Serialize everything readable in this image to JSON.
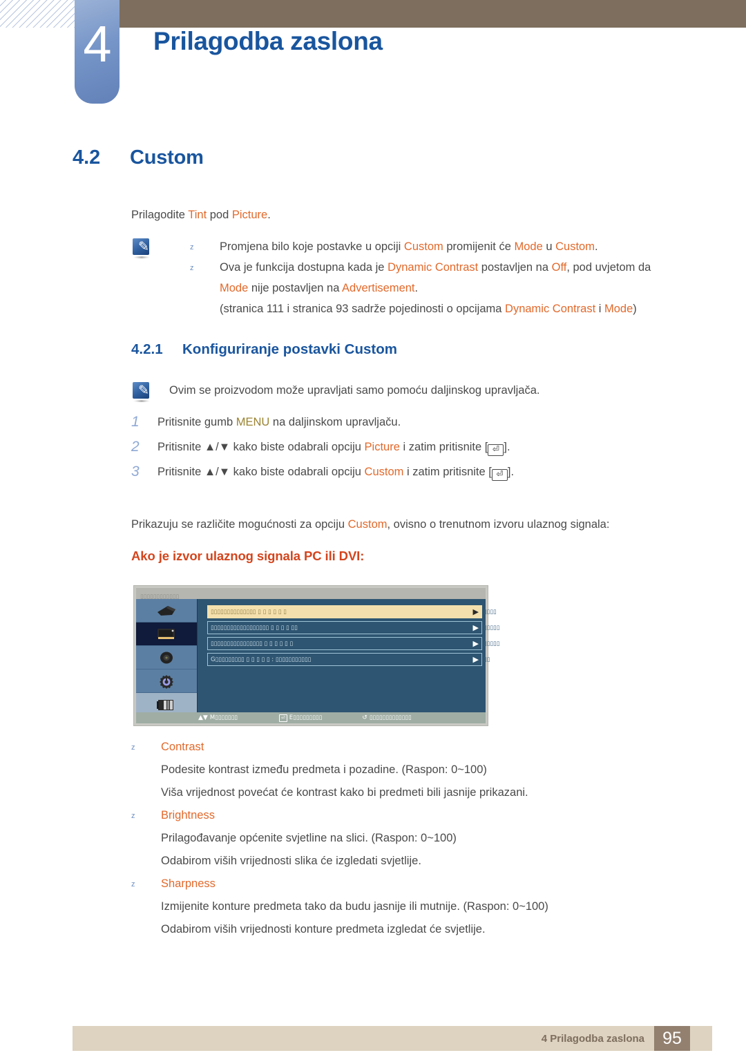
{
  "header": {
    "chapter_number": "4",
    "chapter_title": "Prilagodba zaslona"
  },
  "section": {
    "number": "4.2",
    "title": "Custom",
    "intro_pre": "Prilagodite ",
    "intro_kw1": "Tint",
    "intro_mid": " pod ",
    "intro_kw2": "Picture",
    "intro_end": "."
  },
  "note_box_1": {
    "icon": "note-pencil-icon",
    "bullets": [
      {
        "marker": "z",
        "p1": "Promjena bilo koje postavke u opciji ",
        "k1": "Custom",
        "p2": " promijenit će ",
        "k2": "Mode",
        "p3": " u ",
        "k3": "Custom",
        "p4": "."
      },
      {
        "marker": "z",
        "p1": "Ova je funkcija dostupna kada je ",
        "k1": "Dynamic Contrast",
        "p2": " postavljen na ",
        "k2": "Off",
        "p3": ", pod uvjetom da ",
        "k3": "Mode",
        "p4": " nije postavljen na ",
        "k4": "Advertisement",
        "p5": "."
      }
    ],
    "reference": {
      "p1": "(stranica 111 i stranica 93 sadrže pojedinosti o opcijama ",
      "k1": "Dynamic Contrast",
      "p2": " i ",
      "k2": "Mode",
      "p3": ")"
    }
  },
  "subsection": {
    "number": "4.2.1",
    "title": "Konfiguriranje postavki Custom"
  },
  "note_box_2": {
    "icon": "note-pencil-icon",
    "text": "Ovim se proizvodom može upravljati samo pomoću daljinskog upravljača."
  },
  "steps": [
    {
      "number": "1",
      "p1": "Pritisnite gumb ",
      "kw": "MENU",
      "kw_color": "gold",
      "p2": " na daljinskom upravljaču.",
      "has_key": false
    },
    {
      "number": "2",
      "p1": "Pritisnite ▲/▼ kako biste odabrali opciju ",
      "kw": "Picture",
      "kw_color": "orange",
      "p2": " i zatim pritisnite [",
      "key_glyph": "⏎",
      "p3": "].",
      "has_key": true
    },
    {
      "number": "3",
      "p1": "Pritisnite ▲/▼ kako biste odabrali opciju ",
      "kw": "Custom",
      "kw_color": "orange",
      "p2": " i zatim pritisnite [",
      "key_glyph": "⏎",
      "p3": "].",
      "has_key": true
    }
  ],
  "mid_paragraph": {
    "p1": "Prikazuju se različite mogućnosti za opciju ",
    "k1": "Custom",
    "p2": ", ovisno o trenutnom izvoru ulaznog signala:"
  },
  "red_heading": "Ako je izvor ulaznog signala PC ili DVI:",
  "osd": {
    "title_placeholder": "▯▯▯▯▯▯▯▯▯▯▯▯",
    "sidebar_icons": [
      {
        "name": "input-source-icon",
        "selected": false
      },
      {
        "name": "picture-display-icon",
        "selected": true
      },
      {
        "name": "sound-speaker-icon",
        "selected": false
      },
      {
        "name": "setup-gear-icon",
        "selected": false
      },
      {
        "name": "multi-control-icon",
        "selected": false
      }
    ],
    "rows": [
      {
        "label": "▯▯▯▯▯▯▯▯▯▯▯▯▯▯   ▯     ▯     ▯     ▯     ▯     ▯",
        "arrow": "▶",
        "ghost": "▯▯▯▯",
        "highlighted": true
      },
      {
        "label": "▯▯▯▯▯▯▯▯▯▯▯▯▯▯▯▯▯▯    ▯     ▯     ▯    ▯    ▯▯",
        "arrow": "▶",
        "ghost": "▯▯▯▯▯",
        "highlighted": false
      },
      {
        "label": "▯▯▯▯▯▯▯▯▯▯▯▯▯▯▯▯ ▯    ▯     ▯     ▯     ▯     ▯",
        "arrow": "▶",
        "ghost": "▯▯▯▯▯",
        "highlighted": false
      },
      {
        "label": "G▯▯▯▯▯▯▯▯▯ ▯    ▯    ▯    ▯    ▯     : ▯▯▯▯▯▯▯▯▯▯▯",
        "arrow": "▶",
        "ghost": "▯▯",
        "highlighted": false
      }
    ],
    "bottom_bar": [
      {
        "icon": "▲▼",
        "key": "",
        "label": "M▯▯▯▯▯▯▯"
      },
      {
        "icon": "",
        "key": "⏎",
        "label": "E▯▯▯▯▯▯▯▯▯"
      },
      {
        "icon": "↺",
        "key": "",
        "label": "▯▯▯▯▯▯▯▯▯▯▯▯▯"
      }
    ]
  },
  "definitions": [
    {
      "marker": "z",
      "term": "Contrast",
      "lines": [
        "Podesite kontrast između predmeta i pozadine. (Raspon: 0~100)",
        "Viša vrijednost povećat će kontrast kako bi predmeti bili jasnije prikazani."
      ]
    },
    {
      "marker": "z",
      "term": "Brightness",
      "lines": [
        "Prilagođavanje općenite svjetline na slici. (Raspon: 0~100)",
        "Odabirom viših vrijednosti slika će izgledati svjetlije."
      ]
    },
    {
      "marker": "z",
      "term": "Sharpness",
      "lines": [
        "Izmijenite konture predmeta tako da budu jasnije ili mutnije. (Raspon: 0~100)",
        "Odabirom viših vrijednosti konture predmeta izgledat će svjetlije."
      ]
    }
  ],
  "footer": {
    "label": "4 Prilagodba zaslona",
    "page_number": "95"
  },
  "colors": {
    "heading_blue": "#19559e",
    "keyword_orange": "#e2692b",
    "keyword_gold": "#9a8230",
    "red_heading": "#d4451d",
    "header_brown": "#7d6e5d",
    "footer_tan": "#ded2c0",
    "footer_page_brown": "#93806f"
  }
}
